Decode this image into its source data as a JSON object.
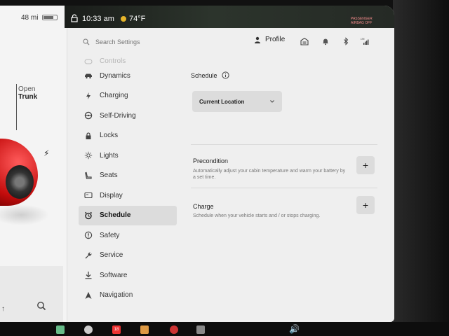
{
  "car": {
    "range": "48 mi",
    "trunk_line1": "Open",
    "trunk_line2": "Trunk"
  },
  "status_bar": {
    "time": "10:33 am",
    "temperature": "74°F",
    "airbag_line1": "PASSENGER",
    "airbag_line2": "AIRBAG OFF"
  },
  "header": {
    "search_placeholder": "Search Settings",
    "profile_label": "Profile"
  },
  "menu": {
    "items": [
      {
        "label": "Controls",
        "icon": "toggle-icon",
        "state": "faded"
      },
      {
        "label": "Dynamics",
        "icon": "car-icon",
        "state": "normal"
      },
      {
        "label": "Charging",
        "icon": "bolt-icon",
        "state": "normal"
      },
      {
        "label": "Self-Driving",
        "icon": "steering-wheel-icon",
        "state": "normal"
      },
      {
        "label": "Locks",
        "icon": "lock-icon",
        "state": "normal"
      },
      {
        "label": "Lights",
        "icon": "light-icon",
        "state": "normal"
      },
      {
        "label": "Seats",
        "icon": "seat-icon",
        "state": "normal"
      },
      {
        "label": "Display",
        "icon": "display-icon",
        "state": "normal"
      },
      {
        "label": "Schedule",
        "icon": "alarm-clock-icon",
        "state": "active"
      },
      {
        "label": "Safety",
        "icon": "safety-icon",
        "state": "normal"
      },
      {
        "label": "Service",
        "icon": "wrench-icon",
        "state": "normal"
      },
      {
        "label": "Software",
        "icon": "download-icon",
        "state": "normal"
      },
      {
        "label": "Navigation",
        "icon": "navigation-icon",
        "state": "normal"
      }
    ]
  },
  "schedule": {
    "title": "Schedule",
    "location_value": "Current Location",
    "precondition_title": "Precondition",
    "precondition_desc": "Automatically adjust your cabin temperature and warm your battery by a set time.",
    "charge_title": "Charge",
    "charge_desc": "Schedule when your vehicle starts and / or stops charging.",
    "add_symbol": "+"
  },
  "taskbar": {
    "calendar_day": "18"
  },
  "colors": {
    "background": "#efefef",
    "active_item": "#dcdcdc",
    "car_red": "#d21414"
  }
}
